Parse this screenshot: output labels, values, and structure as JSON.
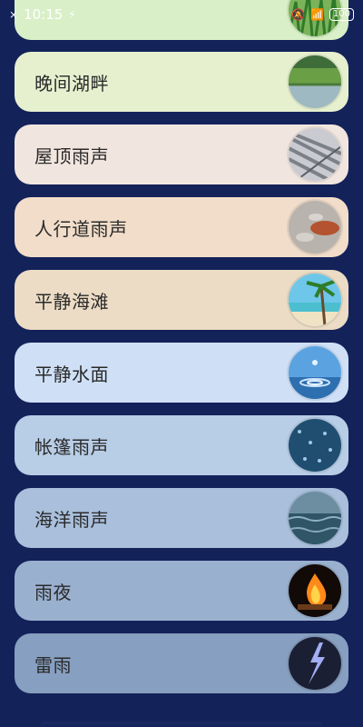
{
  "status": {
    "time": "10:15",
    "battery": "100",
    "icons": [
      "notification-icon",
      "usb-icon",
      "mute-icon",
      "wifi-icon",
      "battery-icon"
    ]
  },
  "sounds": [
    {
      "label": "",
      "bg": "#d9efc7",
      "thumb": "grass"
    },
    {
      "label": "晚间湖畔",
      "bg": "#e6f0cf",
      "thumb": "lake"
    },
    {
      "label": "屋顶雨声",
      "bg": "#f1e6df",
      "thumb": "roof"
    },
    {
      "label": "人行道雨声",
      "bg": "#f1ddc9",
      "thumb": "sidewalk"
    },
    {
      "label": "平静海滩",
      "bg": "#ecdcc5",
      "thumb": "beach"
    },
    {
      "label": "平静水面",
      "bg": "#cfe0f6",
      "thumb": "water-drop"
    },
    {
      "label": "帐篷雨声",
      "bg": "#b8cde6",
      "thumb": "tent"
    },
    {
      "label": "海洋雨声",
      "bg": "#a9bfdb",
      "thumb": "ocean"
    },
    {
      "label": "雨夜",
      "bg": "#9ab0cf",
      "thumb": "fire"
    },
    {
      "label": "雷雨",
      "bg": "#879fc0",
      "thumb": "lightning"
    }
  ]
}
